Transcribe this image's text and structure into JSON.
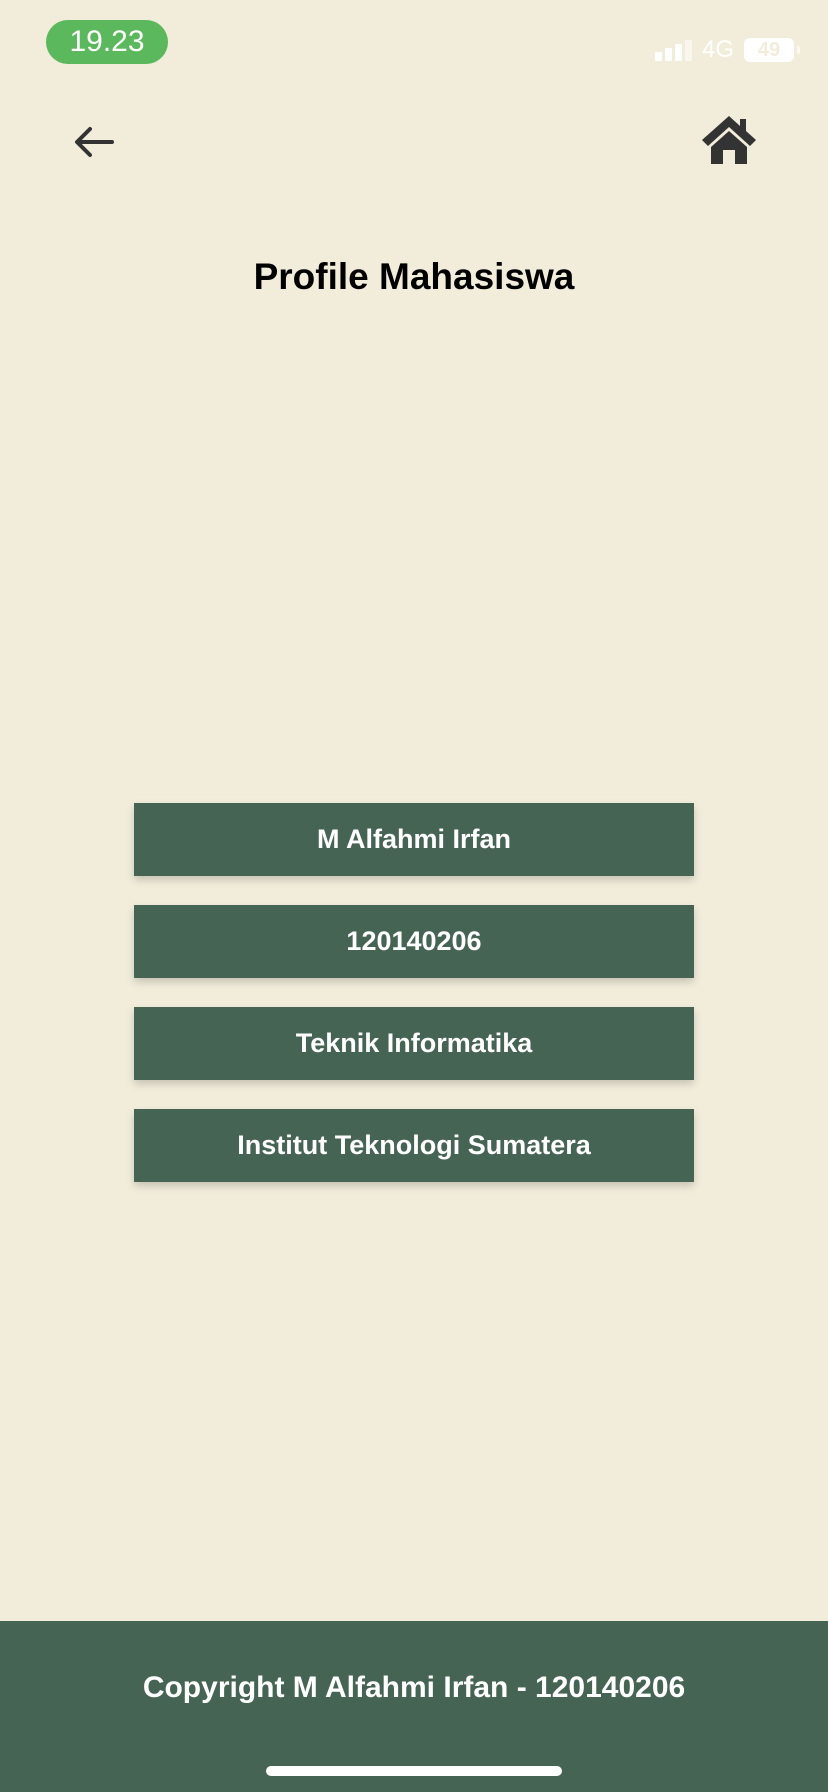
{
  "status_bar": {
    "time": "19.23",
    "network": "4G",
    "battery": "49"
  },
  "nav": {
    "back_icon": "arrow-left-icon",
    "home_icon": "home-icon"
  },
  "page": {
    "title": "Profile Mahasiswa"
  },
  "profile": {
    "items": [
      {
        "label": "M Alfahmi Irfan"
      },
      {
        "label": "120140206"
      },
      {
        "label": "Teknik Informatika"
      },
      {
        "label": "Institut Teknologi Sumatera"
      }
    ]
  },
  "footer": {
    "text": "Copyright M Alfahmi Irfan - 120140206"
  },
  "colors": {
    "background": "#f2eddb",
    "primary": "#466453",
    "time_pill": "#5cb85c"
  }
}
